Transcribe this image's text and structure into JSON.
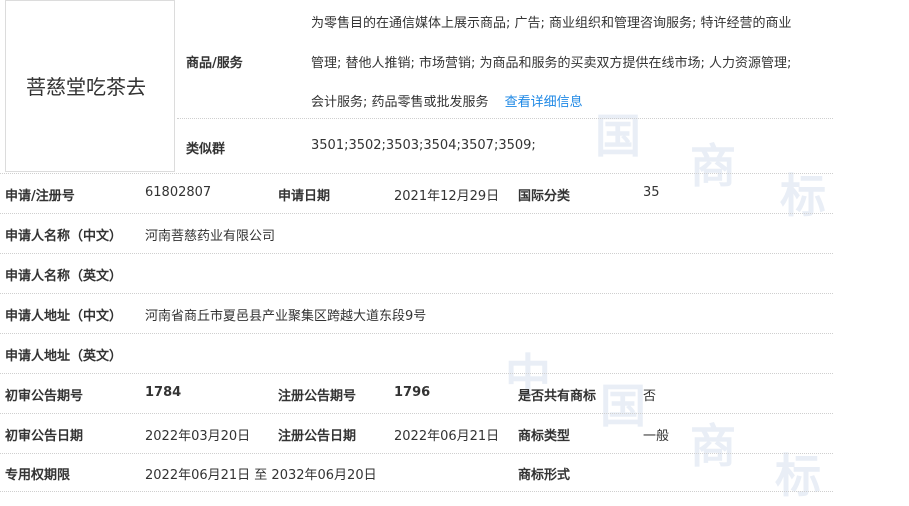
{
  "logo": {
    "text": "菩慈堂吃茶去"
  },
  "goods_services": {
    "label": "商品/服务",
    "lines": [
      "为零售目的在通信媒体上展示商品; 广告; 商业组织和管理咨询服务; 特许经营的商业",
      "管理; 替他人推销; 市场营销; 为商品和服务的买卖双方提供在线市场; 人力资源管理;",
      "会计服务; 药品零售或批发服务"
    ],
    "detail_link": "查看详细信息"
  },
  "similar_group": {
    "label": "类似群",
    "value": "3501;3502;3503;3504;3507;3509;"
  },
  "rows": {
    "reg_no_label": "申请/注册号",
    "reg_no": "61802807",
    "apply_date_label": "申请日期",
    "apply_date": "2021年12月29日",
    "intl_class_label": "国际分类",
    "intl_class": "35",
    "applicant_cn_label": "申请人名称（中文）",
    "applicant_cn": "河南菩慈药业有限公司",
    "applicant_en_label": "申请人名称（英文）",
    "applicant_en": "",
    "address_cn_label": "申请人地址（中文）",
    "address_cn": "河南省商丘市夏邑县产业聚集区跨越大道东段9号",
    "address_en_label": "申请人地址（英文）",
    "address_en": "",
    "prelim_no_label": "初审公告期号",
    "prelim_no": "1784",
    "reg_pub_no_label": "注册公告期号",
    "reg_pub_no": "1796",
    "shared_label": "是否共有商标",
    "shared": "否",
    "prelim_date_label": "初审公告日期",
    "prelim_date": "2022年03月20日",
    "reg_pub_date_label": "注册公告日期",
    "reg_pub_date": "2022年06月21日",
    "tm_type_label": "商标类型",
    "tm_type": "一般",
    "exclusive_label": "专用权期限",
    "exclusive": "2022年06月21日 至 2032年06月20日",
    "tm_form_label": "商标形式",
    "tm_form": ""
  },
  "colors": {
    "link": "#1e88e5",
    "divider": "#cfcfcf",
    "watermark": "#e9eef6"
  }
}
